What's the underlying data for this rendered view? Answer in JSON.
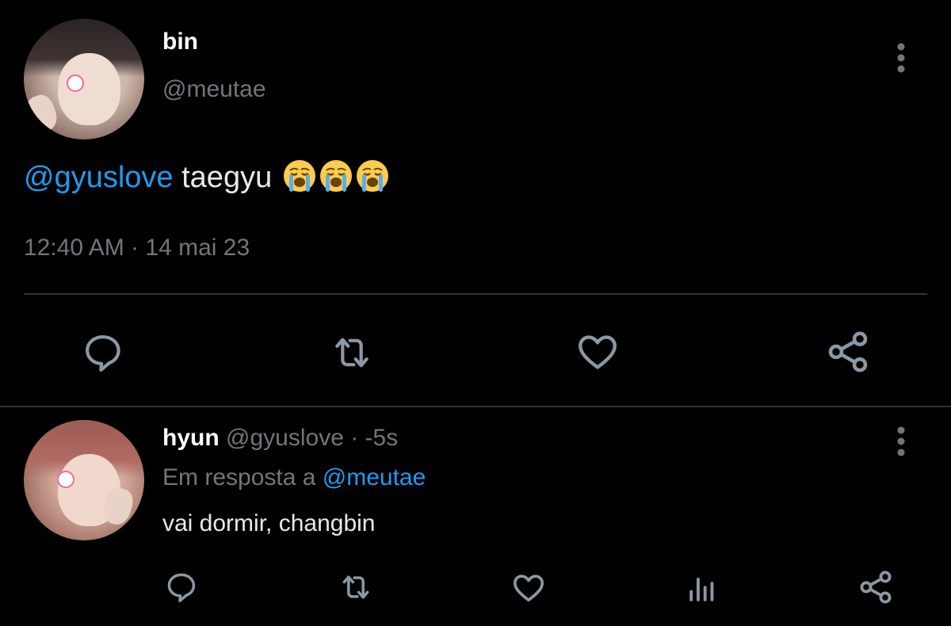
{
  "main_tweet": {
    "author_name": "bin",
    "author_handle": "@meutae",
    "mention": "@gyuslove",
    "text": " taegyu ",
    "emojis": [
      "loudly-crying-face",
      "loudly-crying-face",
      "loudly-crying-face"
    ],
    "timestamp": "12:40 AM · 14 mai 23",
    "actions": [
      "reply-icon",
      "retweet-icon",
      "like-icon",
      "share-icon"
    ]
  },
  "reply_tweet": {
    "author_name": "hyun",
    "author_handle": "@gyuslove",
    "time_sep": " · ",
    "time": "-5s",
    "context_prefix": "Em resposta a ",
    "context_mention": "@meutae",
    "text": "vai dormir, changbin",
    "actions": [
      "reply-icon",
      "retweet-icon",
      "like-icon",
      "analytics-icon",
      "share-icon"
    ]
  },
  "colors": {
    "background": "#000000",
    "text": "#e7e9ea",
    "secondary": "#71767b",
    "link": "#1d9bf0",
    "divider": "#2f3336"
  }
}
